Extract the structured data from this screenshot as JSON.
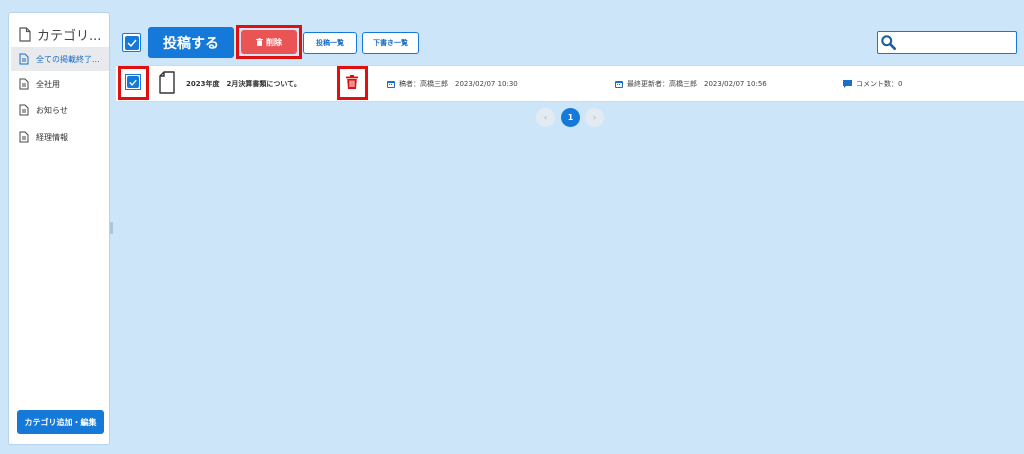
{
  "sidebar": {
    "title": "カテゴリ...",
    "items": [
      {
        "label": "全ての掲載終了..."
      },
      {
        "label": "全社用"
      },
      {
        "label": "お知らせ"
      },
      {
        "label": "経理情報"
      }
    ],
    "add_button": "カテゴリ追加・編集"
  },
  "toolbar": {
    "post_label": "投稿する",
    "delete_label": "削除",
    "post_list_label": "投稿一覧",
    "draft_list_label": "下書き一覧",
    "search_placeholder": ""
  },
  "rows": [
    {
      "title": "2023年度　2月決算書類について。",
      "posted": "稿者：高橋三郎　2023/02/07 10:30",
      "updated": "最終更新者：高橋三郎　2023/02/07 10:56",
      "comments": "コメント数：0"
    }
  ],
  "pagination": {
    "prev": "‹",
    "current": "1",
    "next": "›"
  },
  "colors": {
    "accent": "#1479d9",
    "danger": "#ea5455",
    "highlight": "#e01010",
    "background": "#cde5f8"
  }
}
